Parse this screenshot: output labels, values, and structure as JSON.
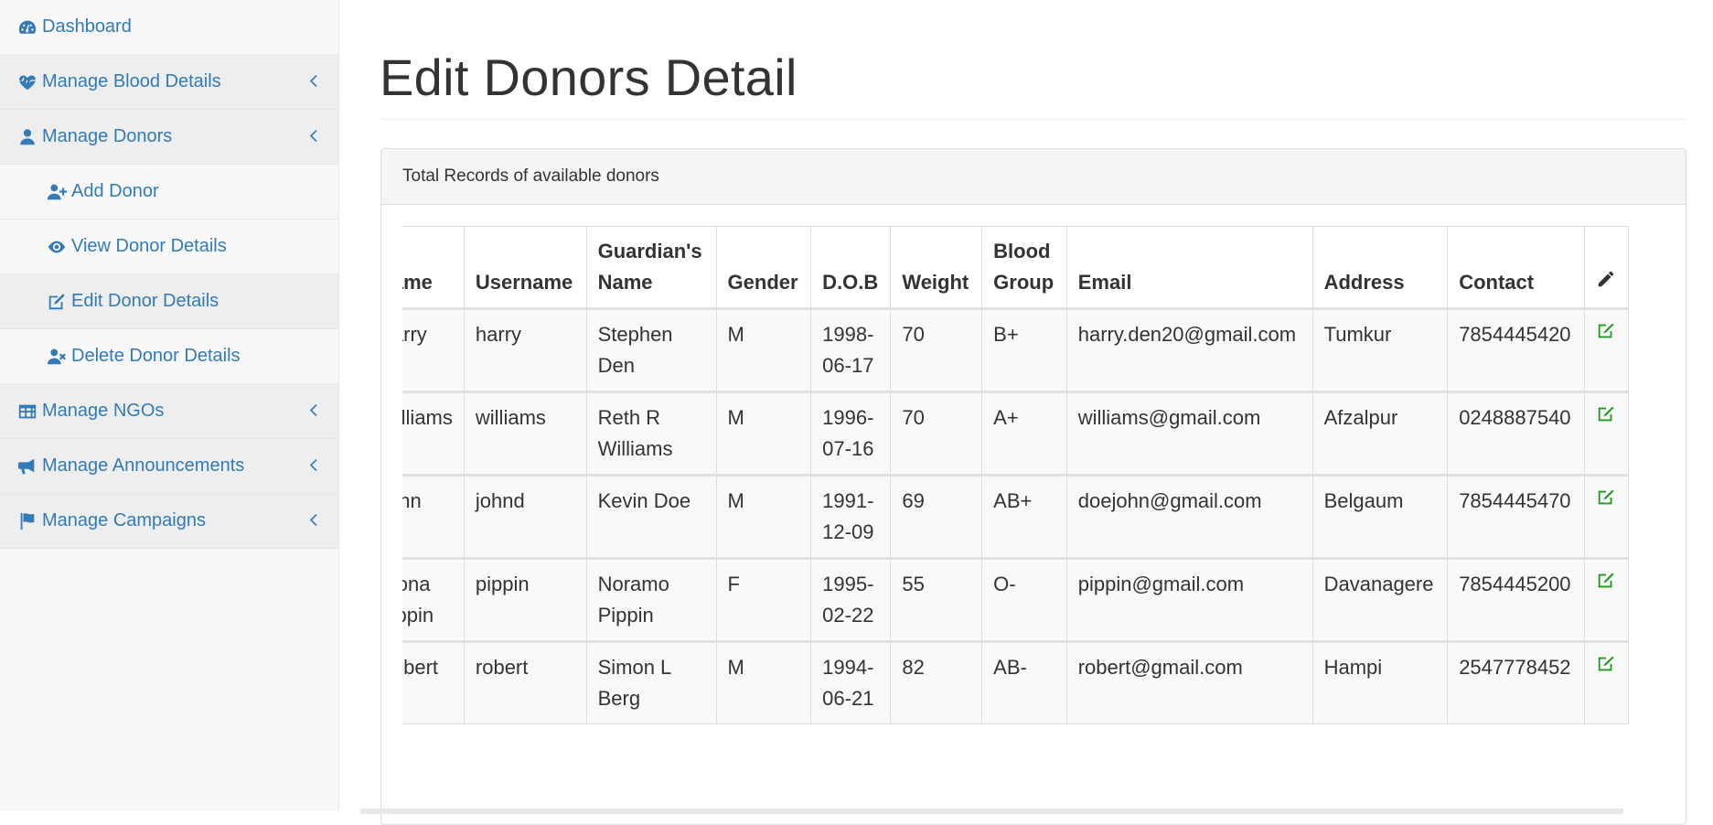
{
  "sidebar": {
    "items": [
      {
        "label": "Dashboard",
        "icon": "dashboard-icon",
        "level": "top",
        "has_chevron": false
      },
      {
        "label": "Manage Blood Details",
        "icon": "heartbeat-icon",
        "level": "top",
        "has_chevron": true
      },
      {
        "label": "Manage Donors",
        "icon": "user-icon",
        "level": "top",
        "has_chevron": true
      },
      {
        "label": "Add Donor",
        "icon": "user-plus-icon",
        "level": "sub",
        "has_chevron": false
      },
      {
        "label": "View Donor Details",
        "icon": "eye-icon",
        "level": "sub",
        "has_chevron": false
      },
      {
        "label": "Edit Donor Details",
        "icon": "edit-icon",
        "level": "sub",
        "has_chevron": false
      },
      {
        "label": "Delete Donor Details",
        "icon": "user-times-icon",
        "level": "sub",
        "has_chevron": false
      },
      {
        "label": "Manage NGOs",
        "icon": "table-icon",
        "level": "top",
        "has_chevron": true
      },
      {
        "label": "Manage Announcements",
        "icon": "bullhorn-icon",
        "level": "top",
        "has_chevron": true
      },
      {
        "label": "Manage Campaigns",
        "icon": "flag-icon",
        "level": "top",
        "has_chevron": true
      }
    ]
  },
  "page": {
    "title": "Edit Donors Detail"
  },
  "panel": {
    "heading": "Total Records of available donors"
  },
  "table": {
    "columns": [
      "Name",
      "Username",
      "Guardian's Name",
      "Gender",
      "D.O.B",
      "Weight",
      "Blood Group",
      "Email",
      "Address",
      "Contact"
    ],
    "edit_column_icon": "pencil-icon",
    "rows": [
      {
        "name": "Harry",
        "username": "harry",
        "guardian": "Stephen Den",
        "gender": "M",
        "dob": "1998-06-17",
        "weight": "70",
        "blood_group": "B+",
        "email": "harry.den20@gmail.com",
        "address": "Tumkur",
        "contact": "7854445420"
      },
      {
        "name": "Williams",
        "username": "williams",
        "guardian": "Reth R Williams",
        "gender": "M",
        "dob": "1996-07-16",
        "weight": "70",
        "blood_group": "A+",
        "email": "williams@gmail.com",
        "address": "Afzalpur",
        "contact": "0248887540"
      },
      {
        "name": "John",
        "username": "johnd",
        "guardian": "Kevin Doe",
        "gender": "M",
        "dob": "1991-12-09",
        "weight": "69",
        "blood_group": "AB+",
        "email": "doejohn@gmail.com",
        "address": "Belgaum",
        "contact": "7854445470"
      },
      {
        "name": "Diona Pippin",
        "username": "pippin",
        "guardian": "Noramo Pippin",
        "gender": "F",
        "dob": "1995-02-22",
        "weight": "55",
        "blood_group": "O-",
        "email": "pippin@gmail.com",
        "address": "Davanagere",
        "contact": "7854445200"
      },
      {
        "name": "Robert",
        "username": "robert",
        "guardian": "Simon L Berg",
        "gender": "M",
        "dob": "1994-06-21",
        "weight": "82",
        "blood_group": "AB-",
        "email": "robert@gmail.com",
        "address": "Hampi",
        "contact": "2547778452"
      }
    ]
  },
  "colors": {
    "link": "#337ab7",
    "edit_icon": "#1e9c1e",
    "sidebar_bg": "#f8f8f8",
    "sidebar_active_bg": "#eeeeee"
  }
}
